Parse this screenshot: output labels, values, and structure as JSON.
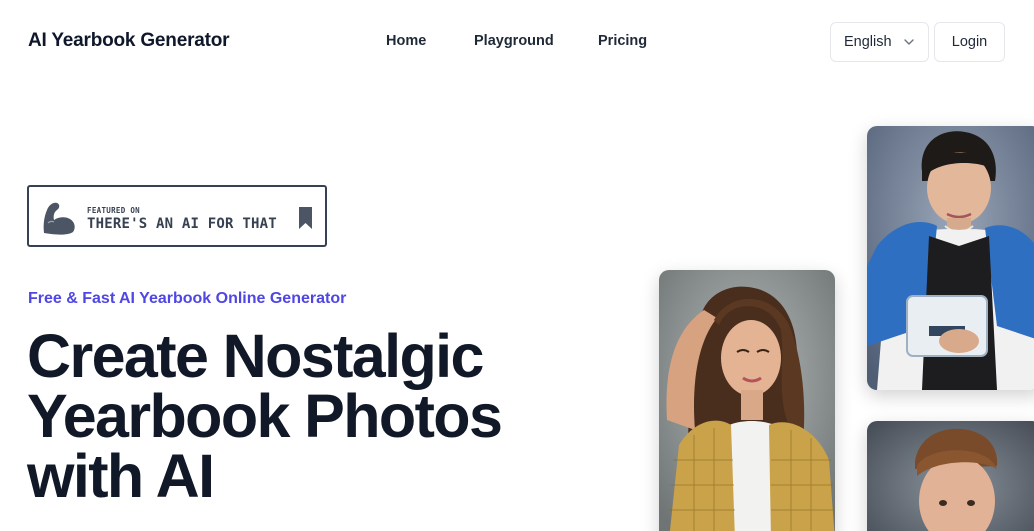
{
  "header": {
    "brand": "AI Yearbook Generator",
    "nav": [
      {
        "label": "Home"
      },
      {
        "label": "Playground"
      },
      {
        "label": "Pricing"
      }
    ],
    "language": {
      "selected": "English",
      "icon": "chevron-down-icon"
    },
    "login_label": "Login"
  },
  "badge": {
    "featured_label": "FEATURED ON",
    "name": "THERE'S AN AI FOR THAT",
    "icons": [
      "flexed-arm-icon",
      "bookmark-icon"
    ]
  },
  "hero": {
    "tagline": "Free & Fast AI Yearbook Online Generator",
    "headline_lines": [
      "Create Nostalgic",
      "Yearbook Photos",
      "with AI"
    ]
  },
  "colors": {
    "accent": "#4f46e5",
    "text": "#111827",
    "border": "#e5e7eb"
  }
}
